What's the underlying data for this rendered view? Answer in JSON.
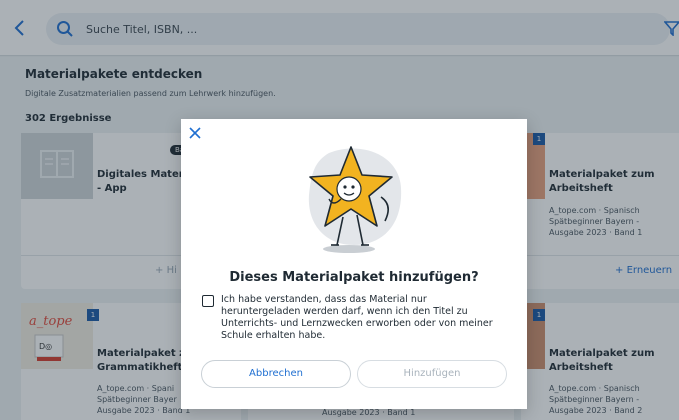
{
  "search": {
    "placeholder": "Suche Titel, ISBN, ..."
  },
  "section": {
    "title": "Materialpakete entdecken",
    "subtitle": "Digitale Zusatzmaterialien passend zum Lehrwerk hinzufügen.",
    "result_count": "302 Ergebnisse"
  },
  "cards": [
    {
      "title_line1": "Digitales Materia",
      "title_line2": "- App",
      "badge": "Ba",
      "action": "Hi"
    },
    {
      "title_line1": "Materialpaket zum",
      "title_line2": "Arbeitsheft",
      "meta1": "A_tope.com · Spanisch",
      "meta2": "Spätbeginner Bayern -",
      "meta3": "Ausgabe 2023 · Band 1",
      "action": "Erneuern",
      "badge_num": "1"
    },
    {
      "title_line1": "Materialpaket zu",
      "title_line2": "Grammatikheft",
      "meta1": "A_tope.com · Spani",
      "meta2": "Spätbeginner Bayer",
      "meta3": "Ausgabe 2023 · Band 1",
      "badge_num": "1"
    },
    {
      "meta3": "Ausgabe 2023 · Band 1"
    },
    {
      "title_line1": "Materialpaket zum",
      "title_line2": "Arbeitsheft",
      "meta1": "A_tope.com · Spanisch",
      "meta2": "Spätbeginner Bayern -",
      "meta3": "Ausgabe 2023 · Band 2",
      "badge_num": "1"
    }
  ],
  "dialog": {
    "title": "Dieses Materialpaket hinzufügen?",
    "checkbox_line1": "Ich habe verstanden, dass das Material nur",
    "checkbox_line2": "heruntergeladen werden darf, wenn ich den Titel zu",
    "checkbox_line3": "Unterrichts- und Lernzwecken erworben oder von meiner",
    "checkbox_line4": "Schule erhalten habe.",
    "cancel": "Abbrechen",
    "add": "Hinzufügen"
  },
  "colors": {
    "accent": "#1f6fd1",
    "star": "#f2b320",
    "badge": "#1a5aa6"
  }
}
